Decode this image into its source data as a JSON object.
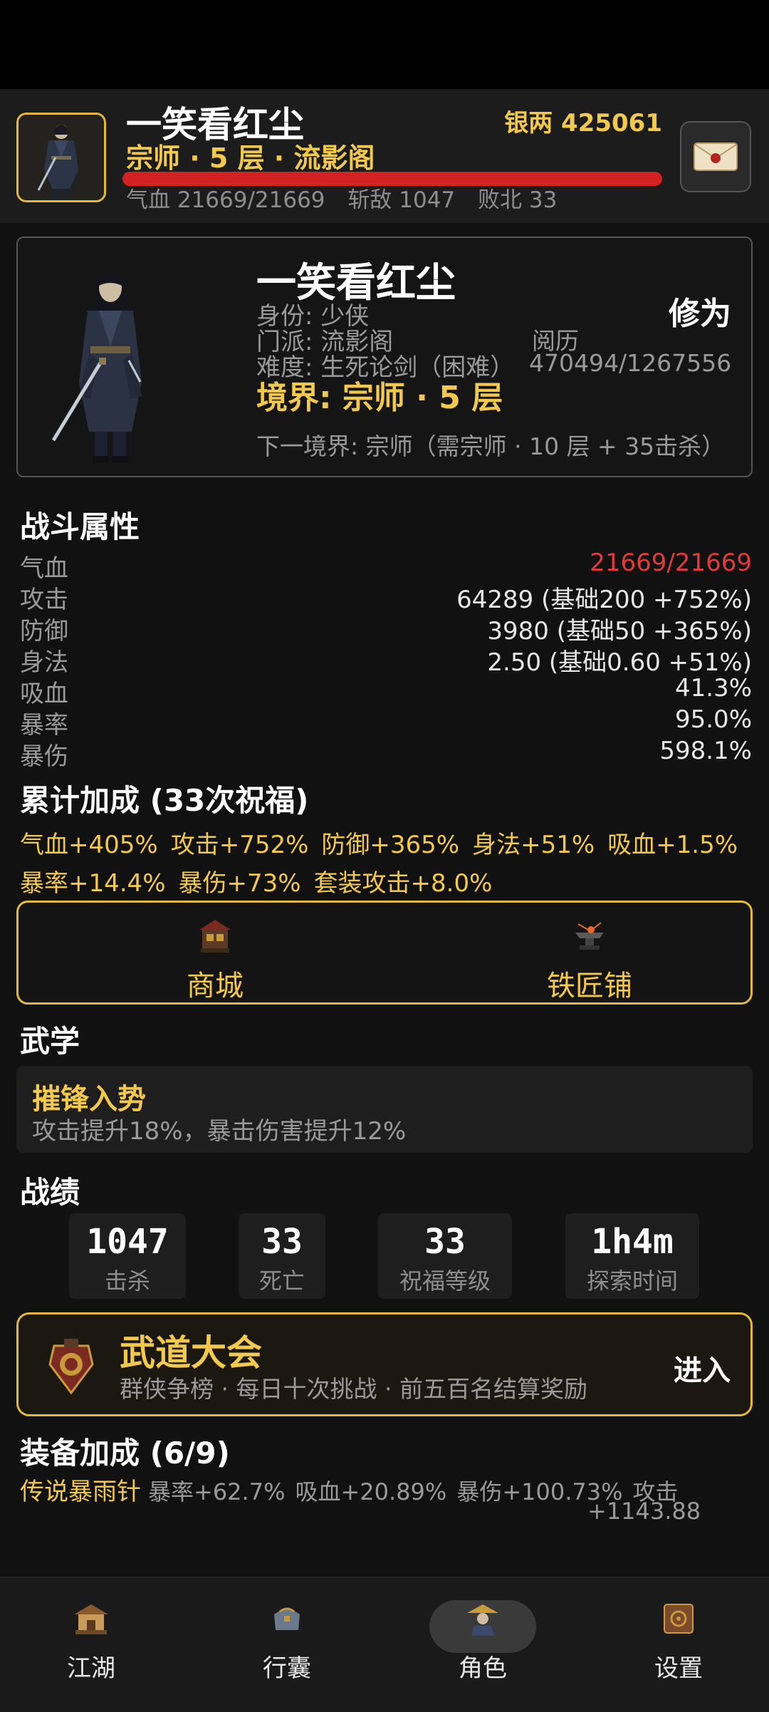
{
  "header": {
    "name": "一笑看红尘",
    "silver": "银两 425061",
    "rank": "宗师 · 5 层 · 流影阁",
    "hp_fraction": 1.0,
    "hp_text": "气血 21669/21669",
    "kills_text": "斩敌 1047",
    "defeats_text": "败北 33"
  },
  "profile": {
    "name": "一笑看红尘",
    "identity": "身份: 少侠",
    "sect": "门派: 流影阁",
    "difficulty": "难度: 生死论剑（困难）",
    "realm": "境界: 宗师 · 5 层",
    "next_realm": "下一境界: 宗师（需宗师 · 10 层 + 35击杀）",
    "cultivation_label": "修为",
    "experience_label": "阅历",
    "experience_value": "470494/1267556"
  },
  "combat": {
    "title": "战斗属性",
    "attributes": [
      {
        "label": "气血",
        "value": "21669/21669"
      },
      {
        "label": "攻击",
        "value": "64289 (基础200 +752%)"
      },
      {
        "label": "防御",
        "value": "3980 (基础50 +365%)"
      },
      {
        "label": "身法",
        "value": "2.50 (基础0.60 +51%)"
      },
      {
        "label": "吸血",
        "value": "41.3%"
      },
      {
        "label": "暴率",
        "value": "95.0%"
      },
      {
        "label": "暴伤",
        "value": "598.1%"
      }
    ]
  },
  "bonus": {
    "title": "累计加成 (33次祝福)",
    "line1": [
      "气血+405%",
      "攻击+752%",
      "防御+365%",
      "身法+51%",
      "吸血+1.5%"
    ],
    "line2": [
      "暴率+14.4%",
      "暴伤+73%",
      "套装攻击+8.0%"
    ]
  },
  "shops": {
    "mall": "商城",
    "blacksmith": "铁匠铺"
  },
  "martial": {
    "title": "武学",
    "skill_name": "摧锋入势",
    "skill_desc": "攻击提升18%，暴击伤害提升12%"
  },
  "records": {
    "title": "战绩",
    "items": [
      {
        "value": "1047",
        "label": "击杀"
      },
      {
        "value": "33",
        "label": "死亡"
      },
      {
        "value": "33",
        "label": "祝福等级"
      },
      {
        "value": "1h4m",
        "label": "探索时间"
      }
    ]
  },
  "arena": {
    "title": "武道大会",
    "subtitle": "群侠争榜 · 每日十次挑战 · 前五百名结算奖励",
    "enter": "进入"
  },
  "equipment": {
    "title": "装备加成 (6/9)",
    "item_name": "传说暴雨针",
    "stats": [
      "暴率+62.7%",
      "吸血+20.89%",
      "暴伤+100.73%",
      "攻击"
    ],
    "stat_continuation": "+1143.88"
  },
  "nav": {
    "items": [
      "江湖",
      "行囊",
      "角色",
      "设置"
    ],
    "active": "角色"
  },
  "colors": {
    "gold": "#f2c94c",
    "hp_red": "#d22222",
    "background": "#111111"
  }
}
